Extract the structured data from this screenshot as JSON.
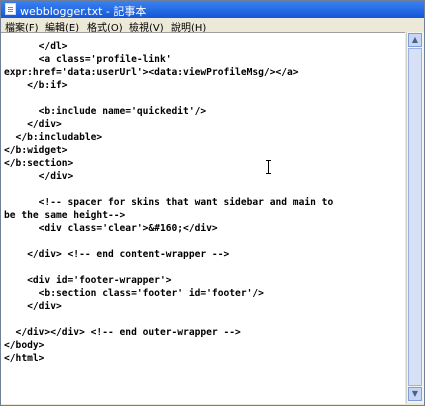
{
  "window": {
    "title": "webblogger.txt - 記事本"
  },
  "menu": [
    "檔案(F)",
    "編輯(E)",
    "格式(O)",
    "檢視(V)",
    "說明(H)"
  ],
  "scrollbar": {
    "up": "▲",
    "down": "▼"
  },
  "editor": {
    "lines": [
      "      </dl>",
      "      <a class='profile-link'",
      "expr:href='data:userUrl'><data:viewProfileMsg/></a>",
      "    </b:if>",
      "",
      "      <b:include name='quickedit'/>",
      "    </div>",
      "  </b:includable>",
      "</b:widget>",
      "</b:section>",
      "      </div>",
      "",
      "      <!-- spacer for skins that want sidebar and main to",
      "be the same height-->",
      "      <div class='clear'>&#160;</div>",
      "",
      "    </div> <!-- end content-wrapper -->",
      "",
      "    <div id='footer-wrapper'>",
      "      <b:section class='footer' id='footer'/>",
      "    </div>",
      "",
      "  </div></div> <!-- end outer-wrapper -->",
      "</body>",
      "</html>"
    ]
  }
}
